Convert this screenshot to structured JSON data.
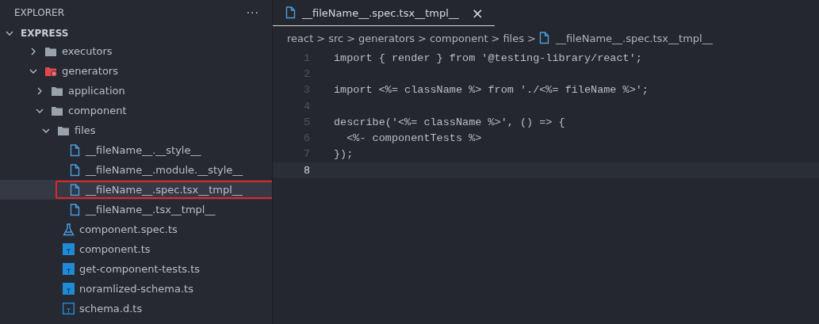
{
  "sidebar": {
    "title": "EXPLORER",
    "more": "···",
    "section": {
      "label": "EXPRESS",
      "expanded": true
    },
    "items": [
      {
        "label": "executors",
        "kind": "folder",
        "expanded": false,
        "selected": false
      },
      {
        "label": "generators",
        "kind": "badgefolder",
        "expanded": true,
        "selected": false,
        "children": [
          {
            "label": "application",
            "kind": "folder",
            "expanded": false,
            "selected": false
          },
          {
            "label": "component",
            "kind": "folder",
            "expanded": true,
            "selected": false,
            "children": [
              {
                "label": "files",
                "kind": "folder",
                "expanded": true,
                "selected": false,
                "children": [
                  {
                    "label": "__fileName__.__style__",
                    "kind": "file",
                    "selected": false
                  },
                  {
                    "label": "__fileName__.module.__style__",
                    "kind": "file",
                    "selected": false
                  },
                  {
                    "label": "__fileName__.spec.tsx__tmpl__",
                    "kind": "file",
                    "selected": true,
                    "annotated": true
                  },
                  {
                    "label": "__fileName__.tsx__tmpl__",
                    "kind": "file",
                    "selected": false
                  }
                ]
              },
              {
                "label": "component.spec.ts",
                "kind": "test",
                "selected": false
              },
              {
                "label": "component.ts",
                "kind": "ts",
                "selected": false
              },
              {
                "label": "get-component-tests.ts",
                "kind": "ts",
                "selected": false
              },
              {
                "label": "noramlized-schema.ts",
                "kind": "ts",
                "selected": false
              },
              {
                "label": "schema.d.ts",
                "kind": "typings",
                "selected": false
              }
            ]
          }
        ]
      }
    ]
  },
  "tabs": [
    {
      "label": "__fileName__.spec.tsx__tmpl__",
      "selected": true,
      "close": "×"
    }
  ],
  "breadcrumbs": [
    {
      "label": "react",
      "kind": "segment"
    },
    {
      "label": "src",
      "kind": "segment"
    },
    {
      "label": "generators",
      "kind": "segment"
    },
    {
      "label": "component",
      "kind": "segment"
    },
    {
      "label": "files",
      "kind": "segment"
    },
    {
      "label": "__fileName__.spec.tsx__tmpl__",
      "kind": "file"
    }
  ],
  "breadcrumb_separator": ">",
  "code": [
    {
      "number": "1",
      "text": "import { render } from '@testing-library/react';",
      "current": false
    },
    {
      "number": "2",
      "current": false
    },
    {
      "number": "3",
      "text": "import <%= className %> from './<%= fileName %>';",
      "current": false
    },
    {
      "number": "4",
      "current": false
    },
    {
      "number": "5",
      "text": "describe('<%= className %>', () => {",
      "current": false
    },
    {
      "number": "6",
      "text": "  <%- componentTests %>",
      "current": false
    },
    {
      "number": "7",
      "text": "});",
      "current": false
    },
    {
      "number": "8",
      "current": true
    }
  ]
}
